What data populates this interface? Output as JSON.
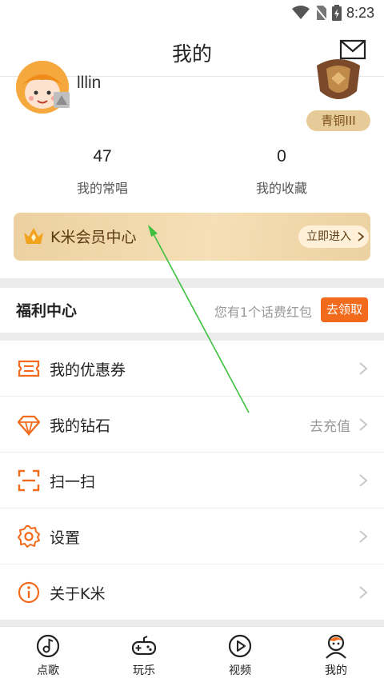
{
  "status": {
    "time": "8:23"
  },
  "header": {
    "title": "我的"
  },
  "profile": {
    "username": "lllin",
    "rank": "青铜III",
    "stats": [
      {
        "value": "47",
        "label": "我的常唱"
      },
      {
        "value": "0",
        "label": "我的收藏"
      }
    ]
  },
  "vip": {
    "title": "K米会员中心",
    "enter": "立即进入"
  },
  "welfare": {
    "title": "福利中心",
    "desc": "您有1个话费红包",
    "button": "去领取"
  },
  "menu": [
    {
      "label": "我的优惠券",
      "value": "",
      "icon": "coupon-icon"
    },
    {
      "label": "我的钻石",
      "value": "去充值",
      "icon": "diamond-icon"
    },
    {
      "label": "扫一扫",
      "value": "",
      "icon": "scan-icon"
    },
    {
      "label": "设置",
      "value": "",
      "icon": "gear-icon"
    },
    {
      "label": "关于K米",
      "value": "",
      "icon": "info-icon"
    }
  ],
  "tabs": [
    {
      "label": "点歌",
      "icon": "music-note-icon"
    },
    {
      "label": "玩乐",
      "icon": "gamepad-icon"
    },
    {
      "label": "视频",
      "icon": "play-icon"
    },
    {
      "label": "我的",
      "icon": "user-icon"
    }
  ],
  "colors": {
    "accent": "#f26b1d",
    "vip_gold": "#ecd0a0",
    "arrow": "#3ec03e"
  }
}
